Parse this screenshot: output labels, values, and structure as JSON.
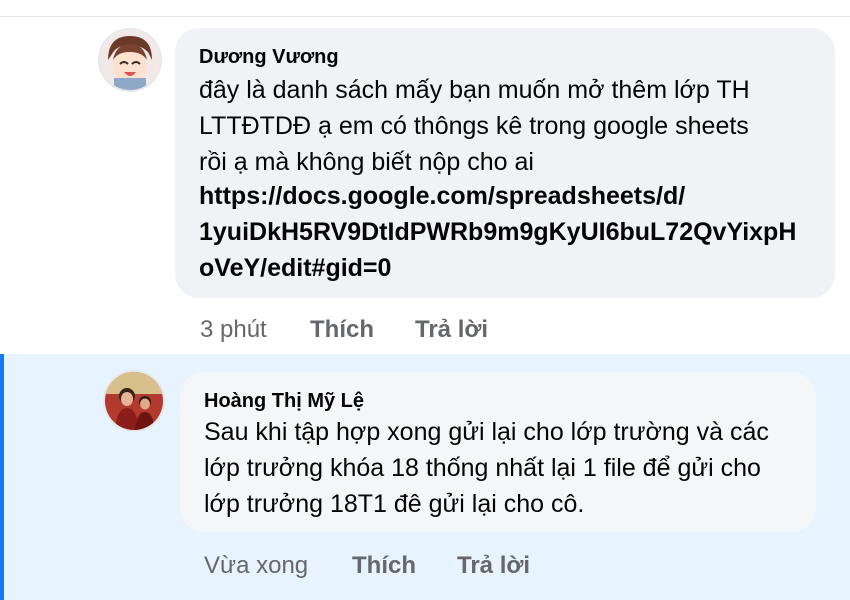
{
  "comments": [
    {
      "author": "Dương Vương",
      "lines": [
        "đây là danh sách mấy bạn muốn mở thêm lớp TH",
        "LTTĐTDĐ ạ em có thôngs kê trong google sheets",
        "rồi ạ mà không biết nộp cho ai"
      ],
      "link_lines": [
        "https://docs.google.com/spreadsheets/d/",
        "1yuiDkH5RV9DtIdPWRb9m9gKyUI6buL72QvYixpH",
        "oVeY/edit#gid=0"
      ],
      "time": "3 phút",
      "like_label": "Thích",
      "reply_label": "Trả lời"
    },
    {
      "author": "Hoàng Thị Mỹ Lệ",
      "lines": [
        "Sau khi tập hợp xong gửi lại cho lớp trường và các",
        "lớp trưởng khóa 18 thống nhất lại 1 file để gửi cho",
        "lớp trưởng 18T1 đê gửi lại cho cô."
      ],
      "time": "Vừa xong",
      "like_label": "Thích",
      "reply_label": "Trả lời"
    }
  ],
  "colors": {
    "bubble": "#f0f2f5",
    "highlight": "#e7f3ff",
    "accent": "#1877f2",
    "meta_text": "#65676b"
  }
}
